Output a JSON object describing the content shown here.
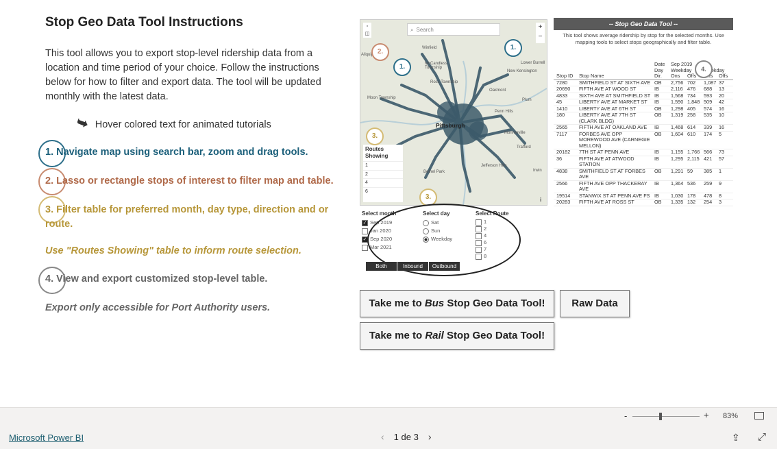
{
  "instructions": {
    "title": "Stop Geo Data Tool Instructions",
    "intro": "This tool allows you to export stop-level ridership data from a location and time period of your choice. Follow the instructions below for how to filter and export data. The tool will be updated monthly with the latest data.",
    "hover_hint": "Hover colored text for animated tutorials",
    "step1": "1. Navigate map using search bar, zoom and drag tools.",
    "step2": "2. Lasso or rectangle stops of interest to filter map and table.",
    "step3": "3. Filter table for preferred month, day type, direction and or route.",
    "routes_note": "Use \"Routes Showing\" table to inform route selection.",
    "step4": "4. View and export customized stop-level table.",
    "export_note": "Export only accessible for Port Authority users."
  },
  "map": {
    "search_placeholder": "Search",
    "city_label": "Pittsburgh",
    "places": [
      "Winfield",
      "McCandless Township",
      "Ross Township",
      "New Kensington",
      "Lower Burrell",
      "Oakmont",
      "Plum",
      "Monroeville",
      "Moon Township",
      "Penn Hills",
      "Trafford",
      "Bethel Park",
      "Irwin",
      "Jefferson Hills",
      "Aliquippa"
    ],
    "routes_showing": {
      "title": "Routes Showing",
      "rows": [
        "1",
        "2",
        "4",
        "6"
      ]
    },
    "zoom_in": "+",
    "zoom_out": "−",
    "info_icon": "i"
  },
  "tutorial_markers": {
    "m1": "1.",
    "m2": "2.",
    "m3": "3.",
    "m4": "4."
  },
  "slicers": {
    "month": {
      "title": "Select month",
      "options": [
        {
          "label": "Sep 2019",
          "checked": true
        },
        {
          "label": "Jan 2020",
          "checked": false
        },
        {
          "label": "Sep 2020",
          "checked": true
        },
        {
          "label": "Mar 2021",
          "checked": false
        }
      ]
    },
    "day": {
      "title": "Select day",
      "options": [
        {
          "label": "Sat",
          "selected": false
        },
        {
          "label": "Sun",
          "selected": false
        },
        {
          "label": "Weekday",
          "selected": true
        }
      ]
    },
    "route": {
      "title": "Select Route",
      "options": [
        "1",
        "2",
        "4",
        "6",
        "7",
        "8"
      ]
    },
    "direction": {
      "options": [
        "Both",
        "Inbound",
        "Outbound"
      ]
    }
  },
  "table": {
    "header": "-- Stop Geo Data Tool --",
    "description": "This tool shows average ridership by stop for the selected months. Use mapping tools to select stops geographically and filter table.",
    "col_group1_top": "Date",
    "col_group1_sub": "Day",
    "col_group1_dir": "Dir.",
    "col_sep2019": "Sep 2019",
    "col_weekday": "Weekday",
    "col_weekday2": "Weekday",
    "col_group2_top": "20",
    "col_stopid": "Stop ID",
    "col_stopname": "Stop Name",
    "col_ons": "Ons",
    "col_offs": "Offs",
    "col_ons2": "Ons",
    "col_offs2": "Offs",
    "rows": [
      {
        "id": "7280",
        "name": "SMITHFIELD ST AT SIXTH AVE",
        "dir": "OB",
        "a": "2,756",
        "b": "702",
        "c": "1,087",
        "d": "37"
      },
      {
        "id": "20690",
        "name": "FIFTH AVE AT WOOD ST",
        "dir": "IB",
        "a": "2,116",
        "b": "476",
        "c": "688",
        "d": "13"
      },
      {
        "id": "4833",
        "name": "SIXTH AVE AT SMITHFIELD ST",
        "dir": "IB",
        "a": "1,568",
        "b": "734",
        "c": "593",
        "d": "20"
      },
      {
        "id": "45",
        "name": "LIBERTY AVE AT MARKET ST",
        "dir": "IB",
        "a": "1,590",
        "b": "1,848",
        "c": "509",
        "d": "42"
      },
      {
        "id": "1410",
        "name": "LIBERTY AVE AT 6TH ST",
        "dir": "OB",
        "a": "1,298",
        "b": "405",
        "c": "574",
        "d": "16"
      },
      {
        "id": "180",
        "name": "LIBERTY AVE AT 7TH ST (CLARK BLDG)",
        "dir": "OB",
        "a": "1,319",
        "b": "258",
        "c": "535",
        "d": "10"
      },
      {
        "id": "2565",
        "name": "FIFTH AVE AT OAKLAND AVE",
        "dir": "IB",
        "a": "1,468",
        "b": "614",
        "c": "339",
        "d": "16"
      },
      {
        "id": "7117",
        "name": "FORBES AVE OPP MOREWOOD AVE (CARNEGIE MELLON)",
        "dir": "OB",
        "a": "1,604",
        "b": "610",
        "c": "174",
        "d": "5"
      },
      {
        "id": "20182",
        "name": "7TH ST AT PENN AVE",
        "dir": "IB",
        "a": "1,155",
        "b": "1,766",
        "c": "566",
        "d": "73"
      },
      {
        "id": "36",
        "name": "FIFTH AVE AT ATWOOD STATION",
        "dir": "IB",
        "a": "1,295",
        "b": "2,115",
        "c": "421",
        "d": "57"
      },
      {
        "id": "4838",
        "name": "SMITHFIELD ST AT FORBES AVE",
        "dir": "OB",
        "a": "1,291",
        "b": "59",
        "c": "385",
        "d": "1"
      },
      {
        "id": "2566",
        "name": "FIFTH AVE OPP THACKERAY AVE",
        "dir": "IB",
        "a": "1,364",
        "b": "536",
        "c": "259",
        "d": "9"
      },
      {
        "id": "19514",
        "name": "STANWIX ST AT PENN AVE FS",
        "dir": "IB",
        "a": "1,030",
        "b": "178",
        "c": "478",
        "d": "8"
      },
      {
        "id": "20283",
        "name": "FIFTH AVE AT ROSS ST",
        "dir": "OB",
        "a": "1,335",
        "b": "132",
        "c": "254",
        "d": "3"
      }
    ]
  },
  "buttons": {
    "bus_prefix": "Take me to ",
    "bus_em": "Bus",
    "bus_suffix": " Stop Geo Data Tool!",
    "raw": "Raw Data",
    "rail_prefix": "Take me to ",
    "rail_em": "Rail",
    "rail_suffix": " Stop Geo Data Tool!"
  },
  "footer": {
    "brand": "Microsoft Power BI",
    "page_indicator": "1 de 3",
    "zoom_pct": "83%",
    "zoom_minus": "-",
    "zoom_plus": "+",
    "zoom_level": 0.42
  }
}
